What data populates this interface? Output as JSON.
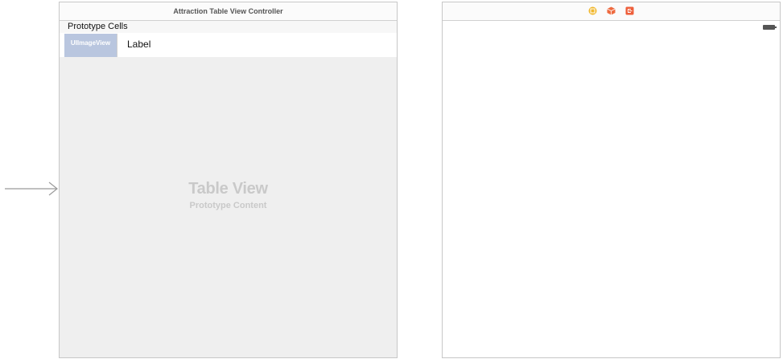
{
  "scenes": {
    "left": {
      "title": "Attraction Table View Controller",
      "section_header": "Prototype Cells",
      "cell": {
        "image_placeholder": "UIImageView",
        "label": "Label"
      },
      "table_view": {
        "title": "Table View",
        "subtitle": "Prototype Content"
      }
    },
    "right": {
      "dock_icons": [
        "view-controller-icon",
        "first-responder-icon",
        "exit-icon"
      ]
    }
  },
  "colors": {
    "image_view_bg": "#b9c6df",
    "table_bg": "#efefef",
    "placeholder_text": "#c9c9c9",
    "dock_view_controller": "#f0b72c",
    "dock_first_responder": "#ee6a3f",
    "dock_exit": "#ee5f3b"
  }
}
